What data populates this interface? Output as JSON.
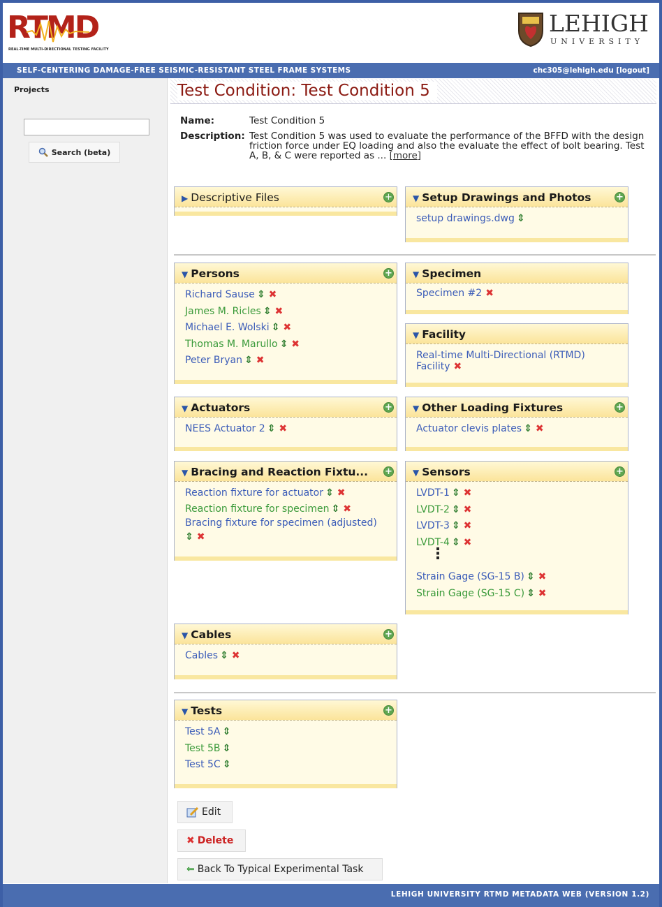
{
  "header": {
    "rtmd_logo": "RTMD",
    "rtmd_sub": "REAL-TIME MULTI-DIRECTIONAL TESTING FACILITY",
    "lehigh_name": "LEHIGH",
    "lehigh_sub": "UNIVERSITY"
  },
  "topbar": {
    "project": "SELF-CENTERING DAMAGE-FREE SEISMIC-RESISTANT STEEL FRAME SYSTEMS",
    "user": "chc305@lehigh.edu [logout]"
  },
  "sidebar": {
    "title": "Projects",
    "search_value": "",
    "search_button": "Search (beta)"
  },
  "page": {
    "title": "Test Condition: Test Condition 5",
    "name_label": "Name:",
    "name_value": "Test Condition 5",
    "desc_label": "Description:",
    "desc_value": "Test Condition 5 was used to evaluate the performance of the BFFD with the design friction force under EQ loading and also the evaluate the effect of bolt bearing. Test A, B, & C were reported as ...",
    "more_link": "[more]"
  },
  "panels": {
    "descriptive_files": {
      "title": "Descriptive Files"
    },
    "setup": {
      "title": "Setup Drawings and Photos",
      "items": [
        "setup drawings.dwg"
      ]
    },
    "persons": {
      "title": "Persons",
      "items": [
        "Richard Sause",
        "James M. Ricles",
        "Michael E. Wolski",
        "Thomas M. Marullo",
        "Peter Bryan"
      ]
    },
    "specimen": {
      "title": "Specimen",
      "items": [
        "Specimen #2"
      ]
    },
    "facility": {
      "title": "Facility",
      "items": [
        "Real-time Multi-Directional (RTMD) Facility"
      ]
    },
    "actuators": {
      "title": "Actuators",
      "items": [
        "NEES Actuator 2"
      ]
    },
    "other_fixtures": {
      "title": "Other Loading Fixtures",
      "items": [
        "Actuator clevis plates"
      ]
    },
    "bracing": {
      "title": "Bracing and Reaction Fixtu...",
      "items": [
        "Reaction fixture for actuator",
        "Reaction fixture for specimen",
        "Bracing fixture for specimen (adjusted)"
      ]
    },
    "sensors": {
      "title": "Sensors",
      "items": [
        "LVDT-1",
        "LVDT-2",
        "LVDT-3",
        "LVDT-4",
        "Strain Gage (SG-15 B)",
        "Strain Gage (SG-15 C)"
      ],
      "ellipsis": "⋮"
    },
    "cables": {
      "title": "Cables",
      "items": [
        "Cables"
      ]
    },
    "tests": {
      "title": "Tests",
      "items": [
        "Test 5A",
        "Test 5B",
        "Test 5C"
      ]
    }
  },
  "buttons": {
    "edit": "Edit",
    "delete": "Delete",
    "back": "Back To Typical Experimental Task"
  },
  "footer": {
    "text": "LEHIGH UNIVERSITY RTMD METADATA WEB (VERSION 1.2)"
  },
  "colors": {
    "brand_blue": "#4a6db0",
    "title_red": "#8b1a12",
    "link_blue": "#3b5cb8",
    "link_green": "#3a9a3a",
    "panel_bg": "#fffbe6"
  },
  "icons": [
    "magnifier-icon",
    "expand-triangle-icon",
    "add-circle-icon",
    "move-arrows-icon",
    "delete-x-icon",
    "edit-pencil-icon",
    "back-arrow-icon"
  ]
}
